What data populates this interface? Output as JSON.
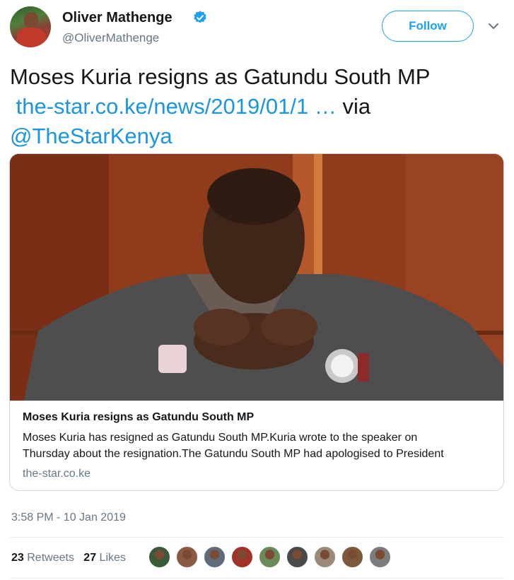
{
  "author": {
    "name": "Oliver Mathenge",
    "handle": "@OliverMathenge"
  },
  "follow_label": "Follow",
  "tweet": {
    "text": "Moses Kuria resigns as Gatundu South MP",
    "link": "the-star.co.ke/news/2019/01/1",
    "ellipsis": "…",
    "via": "via",
    "mention": "@TheStarKenya"
  },
  "card": {
    "title": "Moses Kuria resigns as Gatundu South MP",
    "description_line1": "Moses Kuria has resigned as Gatundu South MP.Kuria wrote to the speaker on",
    "description_line2": "Thursday about the resignation.The Gatundu South MP had apologised to President",
    "domain": "the-star.co.ke"
  },
  "timestamp": "3:58 PM - 10 Jan 2019",
  "stats": {
    "retweets_count": "23",
    "retweets_label": "Retweets",
    "likes_count": "27",
    "likes_label": "Likes"
  },
  "colors": {
    "accent": "#1da1f2",
    "link": "#1b95e0",
    "muted": "#657786"
  },
  "likers": [
    {
      "icon": "liker-avatar",
      "color": "#3b5a3a"
    },
    {
      "icon": "liker-avatar",
      "color": "#8a5a44"
    },
    {
      "icon": "liker-avatar",
      "color": "#5d6b7a"
    },
    {
      "icon": "liker-avatar",
      "color": "#a0322a"
    },
    {
      "icon": "liker-avatar",
      "color": "#6a8a5a"
    },
    {
      "icon": "liker-avatar",
      "color": "#4a4a4a"
    },
    {
      "icon": "liker-avatar",
      "color": "#9a8a7a"
    },
    {
      "icon": "liker-avatar",
      "color": "#7a5a3a"
    },
    {
      "icon": "liker-avatar",
      "color": "#7c7c7c"
    }
  ]
}
